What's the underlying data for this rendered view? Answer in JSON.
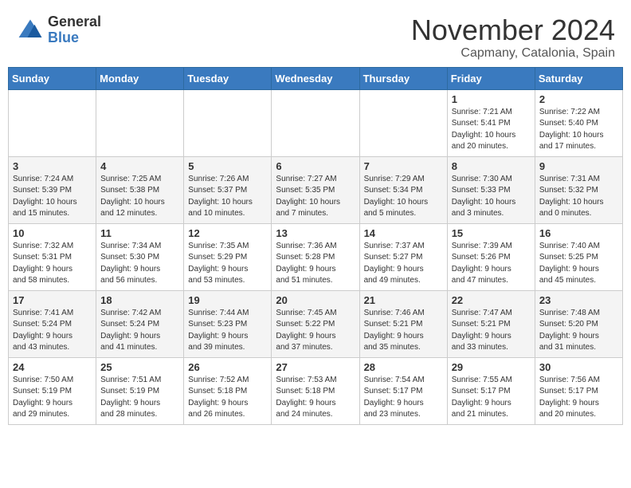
{
  "header": {
    "logo_general": "General",
    "logo_blue": "Blue",
    "month": "November 2024",
    "location": "Capmany, Catalonia, Spain"
  },
  "weekdays": [
    "Sunday",
    "Monday",
    "Tuesday",
    "Wednesday",
    "Thursday",
    "Friday",
    "Saturday"
  ],
  "weeks": [
    [
      {
        "day": "",
        "info": ""
      },
      {
        "day": "",
        "info": ""
      },
      {
        "day": "",
        "info": ""
      },
      {
        "day": "",
        "info": ""
      },
      {
        "day": "",
        "info": ""
      },
      {
        "day": "1",
        "info": "Sunrise: 7:21 AM\nSunset: 5:41 PM\nDaylight: 10 hours\nand 20 minutes."
      },
      {
        "day": "2",
        "info": "Sunrise: 7:22 AM\nSunset: 5:40 PM\nDaylight: 10 hours\nand 17 minutes."
      }
    ],
    [
      {
        "day": "3",
        "info": "Sunrise: 7:24 AM\nSunset: 5:39 PM\nDaylight: 10 hours\nand 15 minutes."
      },
      {
        "day": "4",
        "info": "Sunrise: 7:25 AM\nSunset: 5:38 PM\nDaylight: 10 hours\nand 12 minutes."
      },
      {
        "day": "5",
        "info": "Sunrise: 7:26 AM\nSunset: 5:37 PM\nDaylight: 10 hours\nand 10 minutes."
      },
      {
        "day": "6",
        "info": "Sunrise: 7:27 AM\nSunset: 5:35 PM\nDaylight: 10 hours\nand 7 minutes."
      },
      {
        "day": "7",
        "info": "Sunrise: 7:29 AM\nSunset: 5:34 PM\nDaylight: 10 hours\nand 5 minutes."
      },
      {
        "day": "8",
        "info": "Sunrise: 7:30 AM\nSunset: 5:33 PM\nDaylight: 10 hours\nand 3 minutes."
      },
      {
        "day": "9",
        "info": "Sunrise: 7:31 AM\nSunset: 5:32 PM\nDaylight: 10 hours\nand 0 minutes."
      }
    ],
    [
      {
        "day": "10",
        "info": "Sunrise: 7:32 AM\nSunset: 5:31 PM\nDaylight: 9 hours\nand 58 minutes."
      },
      {
        "day": "11",
        "info": "Sunrise: 7:34 AM\nSunset: 5:30 PM\nDaylight: 9 hours\nand 56 minutes."
      },
      {
        "day": "12",
        "info": "Sunrise: 7:35 AM\nSunset: 5:29 PM\nDaylight: 9 hours\nand 53 minutes."
      },
      {
        "day": "13",
        "info": "Sunrise: 7:36 AM\nSunset: 5:28 PM\nDaylight: 9 hours\nand 51 minutes."
      },
      {
        "day": "14",
        "info": "Sunrise: 7:37 AM\nSunset: 5:27 PM\nDaylight: 9 hours\nand 49 minutes."
      },
      {
        "day": "15",
        "info": "Sunrise: 7:39 AM\nSunset: 5:26 PM\nDaylight: 9 hours\nand 47 minutes."
      },
      {
        "day": "16",
        "info": "Sunrise: 7:40 AM\nSunset: 5:25 PM\nDaylight: 9 hours\nand 45 minutes."
      }
    ],
    [
      {
        "day": "17",
        "info": "Sunrise: 7:41 AM\nSunset: 5:24 PM\nDaylight: 9 hours\nand 43 minutes."
      },
      {
        "day": "18",
        "info": "Sunrise: 7:42 AM\nSunset: 5:24 PM\nDaylight: 9 hours\nand 41 minutes."
      },
      {
        "day": "19",
        "info": "Sunrise: 7:44 AM\nSunset: 5:23 PM\nDaylight: 9 hours\nand 39 minutes."
      },
      {
        "day": "20",
        "info": "Sunrise: 7:45 AM\nSunset: 5:22 PM\nDaylight: 9 hours\nand 37 minutes."
      },
      {
        "day": "21",
        "info": "Sunrise: 7:46 AM\nSunset: 5:21 PM\nDaylight: 9 hours\nand 35 minutes."
      },
      {
        "day": "22",
        "info": "Sunrise: 7:47 AM\nSunset: 5:21 PM\nDaylight: 9 hours\nand 33 minutes."
      },
      {
        "day": "23",
        "info": "Sunrise: 7:48 AM\nSunset: 5:20 PM\nDaylight: 9 hours\nand 31 minutes."
      }
    ],
    [
      {
        "day": "24",
        "info": "Sunrise: 7:50 AM\nSunset: 5:19 PM\nDaylight: 9 hours\nand 29 minutes."
      },
      {
        "day": "25",
        "info": "Sunrise: 7:51 AM\nSunset: 5:19 PM\nDaylight: 9 hours\nand 28 minutes."
      },
      {
        "day": "26",
        "info": "Sunrise: 7:52 AM\nSunset: 5:18 PM\nDaylight: 9 hours\nand 26 minutes."
      },
      {
        "day": "27",
        "info": "Sunrise: 7:53 AM\nSunset: 5:18 PM\nDaylight: 9 hours\nand 24 minutes."
      },
      {
        "day": "28",
        "info": "Sunrise: 7:54 AM\nSunset: 5:17 PM\nDaylight: 9 hours\nand 23 minutes."
      },
      {
        "day": "29",
        "info": "Sunrise: 7:55 AM\nSunset: 5:17 PM\nDaylight: 9 hours\nand 21 minutes."
      },
      {
        "day": "30",
        "info": "Sunrise: 7:56 AM\nSunset: 5:17 PM\nDaylight: 9 hours\nand 20 minutes."
      }
    ]
  ]
}
